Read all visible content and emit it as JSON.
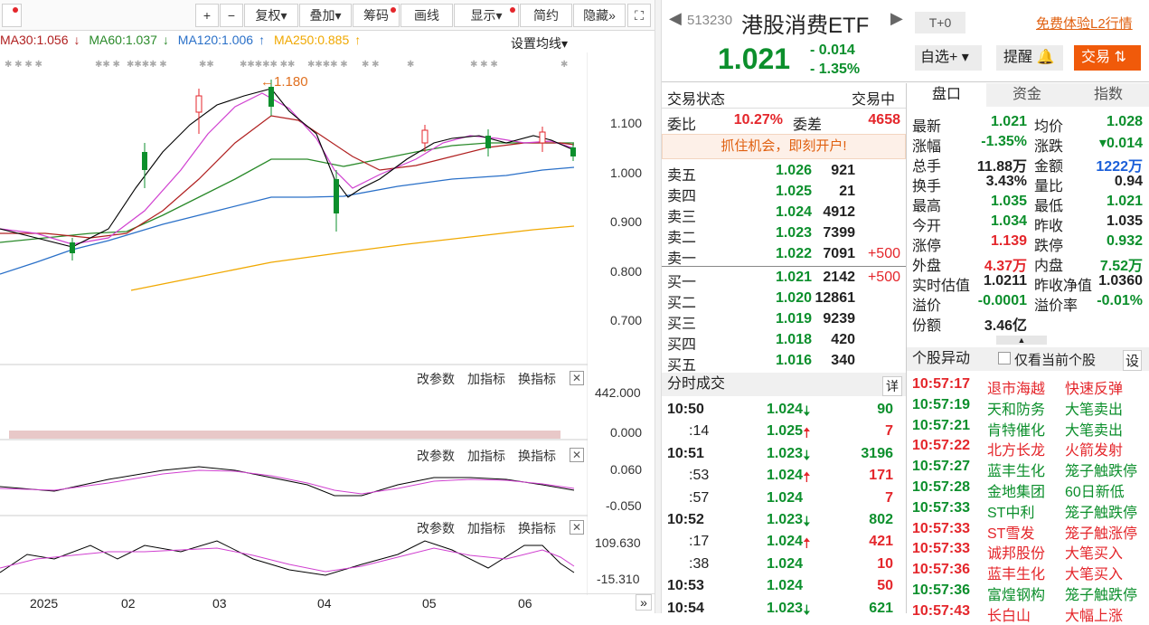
{
  "toolbar": {
    "plus": "+",
    "minus": "−",
    "fuquan": "复权",
    "diejia": "叠加",
    "chouma": "筹码",
    "huaxian": "画线",
    "xianshi": "显示",
    "jianyue": "简约",
    "yincang": "隐藏",
    "expand": "⛶"
  },
  "ma": {
    "ma30": "MA30:1.056",
    "ma60": "MA60:1.037",
    "ma120": "MA120:1.006",
    "ma250": "MA250:0.885",
    "setting": "设置均线"
  },
  "price_axis": [
    "1.100",
    "1.000",
    "0.900",
    "0.800",
    "0.700"
  ],
  "peak_label": "1.180",
  "vol_axis": [
    "442.000",
    "0.000"
  ],
  "macd_axis": [
    "0.060",
    "-0.050"
  ],
  "kdj_axis": [
    "109.630",
    "-15.310"
  ],
  "panel_btns": {
    "gai": "改参数",
    "jia": "加指标",
    "huan": "换指标"
  },
  "x_labels": [
    "2025",
    "02",
    "03",
    "04",
    "05",
    "06"
  ],
  "header": {
    "code": "513230",
    "name": "港股消费ETF",
    "t0": "T+0",
    "trial": "免费体验L2行情",
    "price": "1.021",
    "change": "- 0.014",
    "pct": "- 1.35%",
    "zixuan": "自选+",
    "tixing": "提醒",
    "jiaoyi": "交易"
  },
  "status": {
    "label": "交易状态",
    "value": "交易中",
    "weibi_l": "委比",
    "weibi": "10.27%",
    "weicha_l": "委差",
    "weicha": "4658",
    "promo": "抓住机会，即刻开户!"
  },
  "asks": [
    {
      "l": "卖五",
      "p": "1.026",
      "v": "921",
      "d": ""
    },
    {
      "l": "卖四",
      "p": "1.025",
      "v": "21",
      "d": ""
    },
    {
      "l": "卖三",
      "p": "1.024",
      "v": "4912",
      "d": ""
    },
    {
      "l": "卖二",
      "p": "1.023",
      "v": "7399",
      "d": ""
    },
    {
      "l": "卖一",
      "p": "1.022",
      "v": "7091",
      "d": "+500"
    }
  ],
  "bids": [
    {
      "l": "买一",
      "p": "1.021",
      "v": "2142",
      "d": "+500"
    },
    {
      "l": "买二",
      "p": "1.020",
      "v": "12861",
      "d": ""
    },
    {
      "l": "买三",
      "p": "1.019",
      "v": "9239",
      "d": ""
    },
    {
      "l": "买四",
      "p": "1.018",
      "v": "420",
      "d": ""
    },
    {
      "l": "买五",
      "p": "1.016",
      "v": "340",
      "d": ""
    }
  ],
  "ticks_title": "分时成交",
  "ticks_detail": "详",
  "ticks": [
    {
      "t": "10:50",
      "p": "1.024",
      "a": "down",
      "v": "90",
      "c": "g"
    },
    {
      "t": ":14",
      "p": "1.025",
      "a": "up",
      "v": "7",
      "c": "r"
    },
    {
      "t": "10:51",
      "p": "1.023",
      "a": "down",
      "v": "3196",
      "c": "g"
    },
    {
      "t": ":53",
      "p": "1.024",
      "a": "up",
      "v": "171",
      "c": "r"
    },
    {
      "t": ":57",
      "p": "1.024",
      "a": "",
      "v": "7",
      "c": "r"
    },
    {
      "t": "10:52",
      "p": "1.023",
      "a": "down",
      "v": "802",
      "c": "g"
    },
    {
      "t": ":17",
      "p": "1.024",
      "a": "up",
      "v": "421",
      "c": "r"
    },
    {
      "t": ":38",
      "p": "1.024",
      "a": "",
      "v": "10",
      "c": "r"
    },
    {
      "t": "10:53",
      "p": "1.024",
      "a": "",
      "v": "50",
      "c": "r"
    },
    {
      "t": "10:54",
      "p": "1.023",
      "a": "down",
      "v": "621",
      "c": "g"
    }
  ],
  "tabs": [
    "盘口",
    "资金",
    "指数"
  ],
  "pankou": [
    {
      "l1": "最新",
      "v1": "1.021",
      "c1": "g",
      "l2": "均价",
      "v2": "1.028",
      "c2": "g"
    },
    {
      "l1": "涨幅",
      "v1": "-1.35%",
      "c1": "g",
      "l2": "涨跌",
      "v2": "▾0.014",
      "c2": "g"
    },
    {
      "l1": "总手",
      "v1": "11.88万",
      "c1": "k",
      "l2": "金额",
      "v2": "1222万",
      "c2": "b"
    },
    {
      "l1": "换手",
      "v1": "3.43%",
      "c1": "k",
      "l2": "量比",
      "v2": "0.94",
      "c2": "k"
    },
    {
      "l1": "最高",
      "v1": "1.035",
      "c1": "g",
      "l2": "最低",
      "v2": "1.021",
      "c2": "g"
    },
    {
      "l1": "今开",
      "v1": "1.034",
      "c1": "g",
      "l2": "昨收",
      "v2": "1.035",
      "c2": "k"
    },
    {
      "l1": "涨停",
      "v1": "1.139",
      "c1": "r",
      "l2": "跌停",
      "v2": "0.932",
      "c2": "g"
    },
    {
      "l1": "外盘",
      "v1": "4.37万",
      "c1": "r",
      "l2": "内盘",
      "v2": "7.52万",
      "c2": "g"
    },
    {
      "l1": "实时估值",
      "v1": "1.0211",
      "c1": "k",
      "l2": "昨收净值",
      "v2": "1.0360",
      "c2": "k"
    },
    {
      "l1": "溢价",
      "v1": "-0.0001",
      "c1": "g",
      "l2": "溢价率",
      "v2": "-0.01%",
      "c2": "g"
    },
    {
      "l1": "份额",
      "v1": "3.46亿",
      "c1": "k",
      "l2": "",
      "v2": "",
      "c2": "k"
    }
  ],
  "alerts_title": "个股异动",
  "alerts_check": "仅看当前个股",
  "alerts_set": "设",
  "alerts": [
    {
      "t": "10:57:17",
      "n": "退市海越",
      "e": "快速反弹",
      "c": "r"
    },
    {
      "t": "10:57:19",
      "n": "天和防务",
      "e": "大笔卖出",
      "c": "g"
    },
    {
      "t": "10:57:21",
      "n": "肯特催化",
      "e": "大笔卖出",
      "c": "g"
    },
    {
      "t": "10:57:22",
      "n": "北方长龙",
      "e": "火箭发射",
      "c": "r"
    },
    {
      "t": "10:57:27",
      "n": "蓝丰生化",
      "e": "笼子触跌停",
      "c": "g"
    },
    {
      "t": "10:57:28",
      "n": "金地集团",
      "e": "60日新低",
      "c": "g"
    },
    {
      "t": "10:57:33",
      "n": "ST中利",
      "e": "笼子触跌停",
      "c": "g"
    },
    {
      "t": "10:57:33",
      "n": "ST雪发",
      "e": "笼子触涨停",
      "c": "r"
    },
    {
      "t": "10:57:33",
      "n": "诚邦股份",
      "e": "大笔买入",
      "c": "r"
    },
    {
      "t": "10:57:36",
      "n": "蓝丰生化",
      "e": "大笔买入",
      "c": "r"
    },
    {
      "t": "10:57:36",
      "n": "富煌钢构",
      "e": "笼子触跌停",
      "c": "g"
    },
    {
      "t": "10:57:43",
      "n": "长白山",
      "e": "大幅上涨",
      "c": "r"
    }
  ]
}
